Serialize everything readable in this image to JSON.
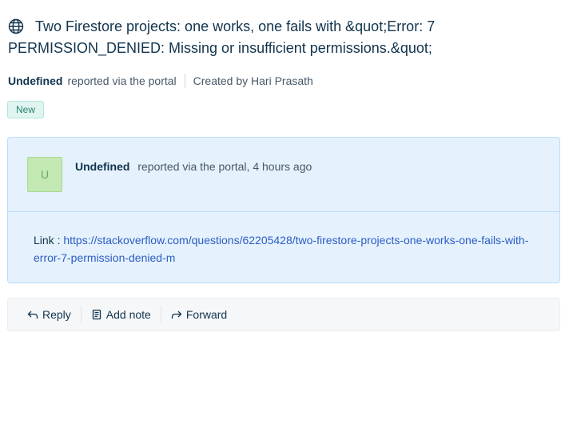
{
  "ticket": {
    "title": "Two Firestore projects: one works, one fails with &quot;Error: 7 PERMISSION_DENIED: Missing or insufficient permissions.&quot;",
    "requester": "Undefined",
    "source_text": "reported via the portal",
    "created_by": "Created by Hari Prasath",
    "status": "New"
  },
  "conversation": {
    "avatar_letter": "U",
    "author": "Undefined",
    "meta": "reported via the portal, 4 hours ago",
    "link_label": "Link :",
    "link_url": "https://stackoverflow.com/questions/62205428/two-firestore-projects-one-works-one-fails-with-error-7-permission-denied-m"
  },
  "actions": {
    "reply": "Reply",
    "add_note": "Add note",
    "forward": "Forward"
  },
  "colors": {
    "status_badge_bg": "#e0f5f1",
    "status_badge_text": "#24836e",
    "conversation_bg": "#e5f2fd",
    "link": "#2c5cc5",
    "avatar_bg": "#c3e8b4"
  },
  "icons": {
    "title": "globe-icon",
    "reply": "reply-arrow-icon",
    "add_note": "note-icon",
    "forward": "forward-arrow-icon"
  }
}
